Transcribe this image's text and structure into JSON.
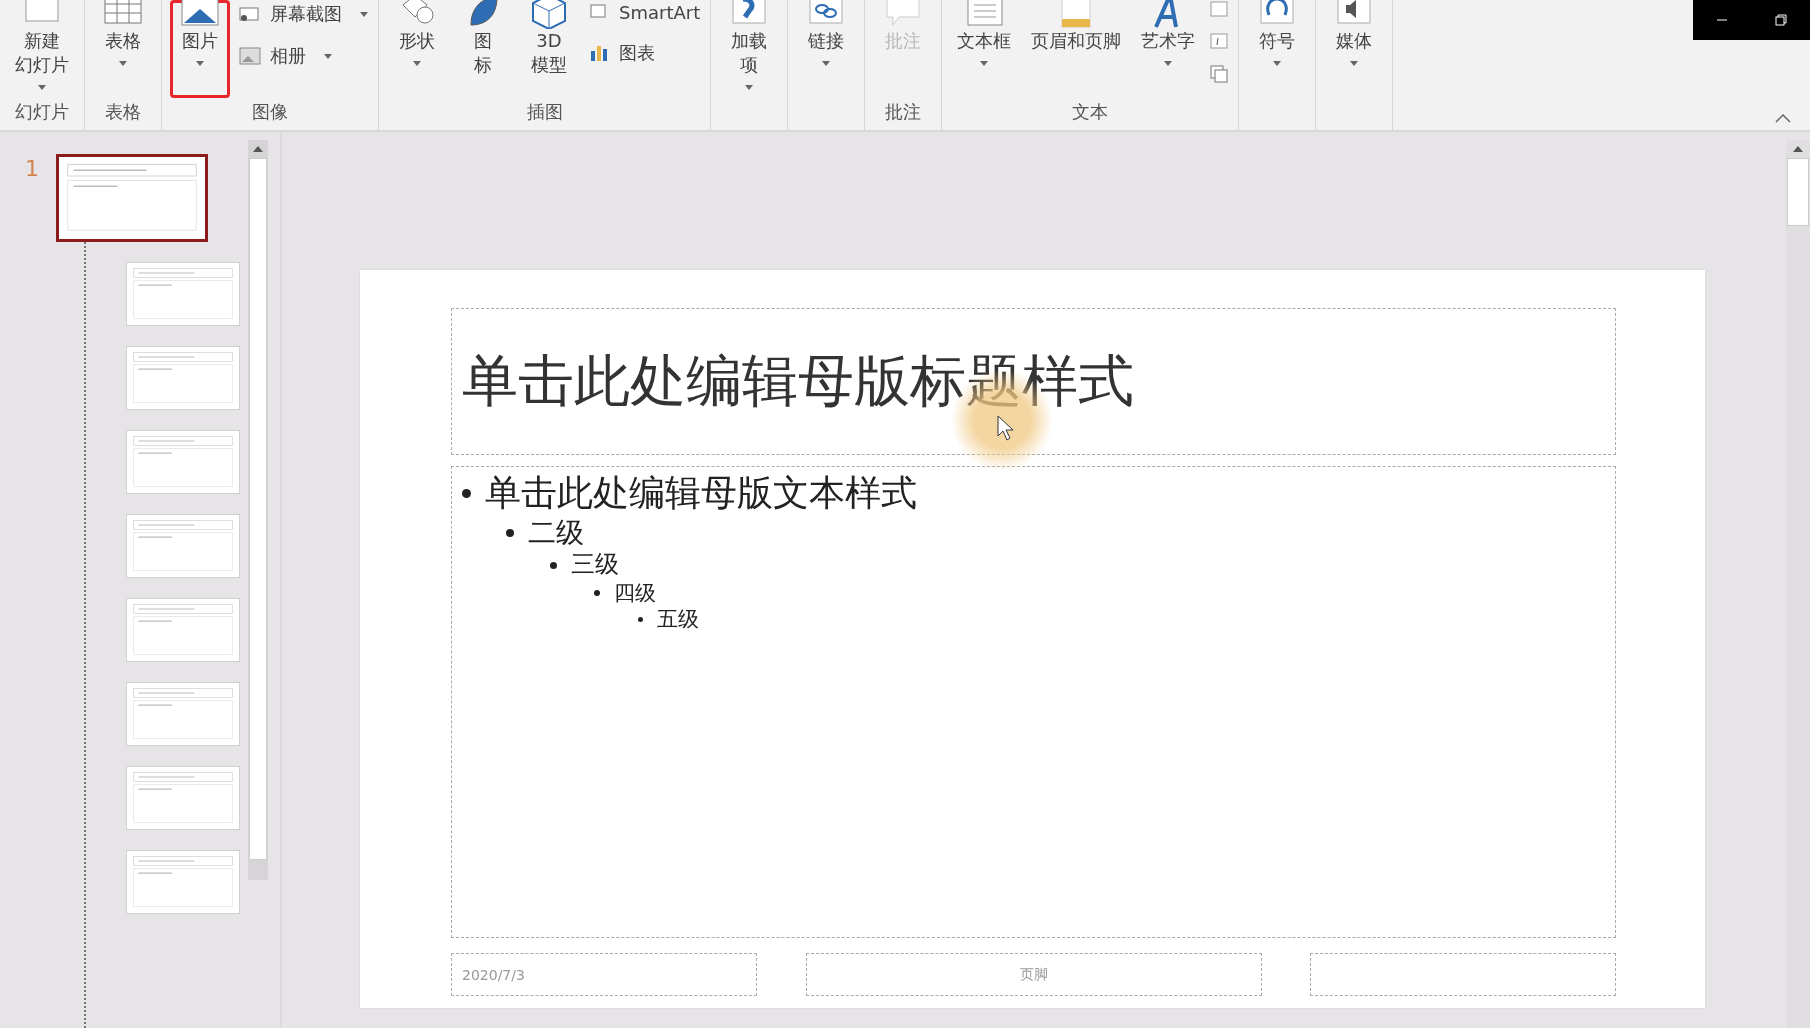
{
  "window": {
    "controls": [
      {
        "kind": "minimize"
      },
      {
        "kind": "restore"
      }
    ]
  },
  "ribbon": {
    "groups": [
      {
        "label": "幻灯片",
        "items": [
          {
            "lines": [
              "新建",
              "幻灯片"
            ],
            "kind": "large",
            "dropdown": true,
            "highlighted": false,
            "disabled": false
          }
        ]
      },
      {
        "label": "表格",
        "items": [
          {
            "lines": [
              "表格"
            ],
            "kind": "large",
            "dropdown": true,
            "highlighted": false,
            "disabled": false
          }
        ]
      },
      {
        "label": "图像",
        "items": [
          {
            "lines": [
              "图片"
            ],
            "kind": "large",
            "dropdown": true,
            "highlighted": true,
            "disabled": false
          },
          {
            "lines": [
              "屏幕截图"
            ],
            "kind": "small",
            "dropdown": true
          },
          {
            "lines": [
              "相册"
            ],
            "kind": "small",
            "dropdown": true
          }
        ]
      },
      {
        "label": "插图",
        "items": [
          {
            "lines": [
              "形状"
            ],
            "kind": "large",
            "dropdown": true,
            "highlighted": false,
            "disabled": false
          },
          {
            "lines": [
              "图",
              "标"
            ],
            "kind": "large",
            "dropdown": false,
            "highlighted": false,
            "disabled": false
          },
          {
            "lines": [
              "3D",
              "模型"
            ],
            "kind": "large",
            "dropdown": false,
            "highlighted": false,
            "disabled": false
          },
          {
            "lines": [
              "SmartArt"
            ],
            "kind": "small",
            "dropdown": false
          },
          {
            "lines": [
              "图表"
            ],
            "kind": "small",
            "dropdown": false
          }
        ]
      },
      {
        "items": [
          {
            "lines": [
              "加载",
              "项"
            ],
            "kind": "large",
            "dropdown": true,
            "highlighted": false,
            "disabled": false
          }
        ]
      },
      {
        "items": [
          {
            "lines": [
              "链接"
            ],
            "kind": "large",
            "dropdown": true,
            "highlighted": false,
            "disabled": false
          }
        ]
      },
      {
        "label": "批注",
        "items": [
          {
            "lines": [
              "批注"
            ],
            "kind": "large",
            "dropdown": false,
            "highlighted": false,
            "disabled": true
          }
        ]
      },
      {
        "label": "文本",
        "items": [
          {
            "lines": [
              "文本框"
            ],
            "kind": "large",
            "dropdown": true,
            "highlighted": false,
            "disabled": false
          },
          {
            "lines": [
              "页眉和页脚"
            ],
            "kind": "large",
            "dropdown": false,
            "highlighted": false,
            "disabled": false
          },
          {
            "lines": [
              "艺术字"
            ],
            "kind": "large",
            "dropdown": true,
            "highlighted": false,
            "disabled": false
          },
          {
            "kind": "icons"
          }
        ]
      },
      {
        "items": [
          {
            "lines": [
              "符号"
            ],
            "kind": "large",
            "dropdown": true,
            "highlighted": false,
            "disabled": false
          }
        ]
      },
      {
        "items": [
          {
            "lines": [
              "媒体"
            ],
            "kind": "large",
            "dropdown": true,
            "highlighted": false,
            "disabled": false
          }
        ]
      }
    ]
  },
  "thumbnails": {
    "number": "1",
    "items": [
      {
        "kind": "master",
        "selected": true
      },
      {
        "kind": "layout",
        "selected": false
      },
      {
        "kind": "layout",
        "selected": false
      },
      {
        "kind": "layout",
        "selected": false
      },
      {
        "kind": "layout",
        "selected": false
      },
      {
        "kind": "layout",
        "selected": false
      },
      {
        "kind": "layout",
        "selected": false
      },
      {
        "kind": "layout",
        "selected": false
      },
      {
        "kind": "layout",
        "selected": false
      }
    ]
  },
  "slide": {
    "title": "单击此处编辑母版标题样式",
    "body": [
      {
        "text": "单击此处编辑母版文本样式",
        "children": [
          {
            "text": "二级",
            "children": [
              {
                "text": "三级",
                "children": [
                  {
                    "text": "四级",
                    "children": [
                      {
                        "text": "五级"
                      }
                    ]
                  }
                ]
              }
            ]
          }
        ]
      }
    ],
    "footers": [
      {
        "text": "2020/7/3"
      },
      {
        "text": "页脚"
      }
    ]
  }
}
